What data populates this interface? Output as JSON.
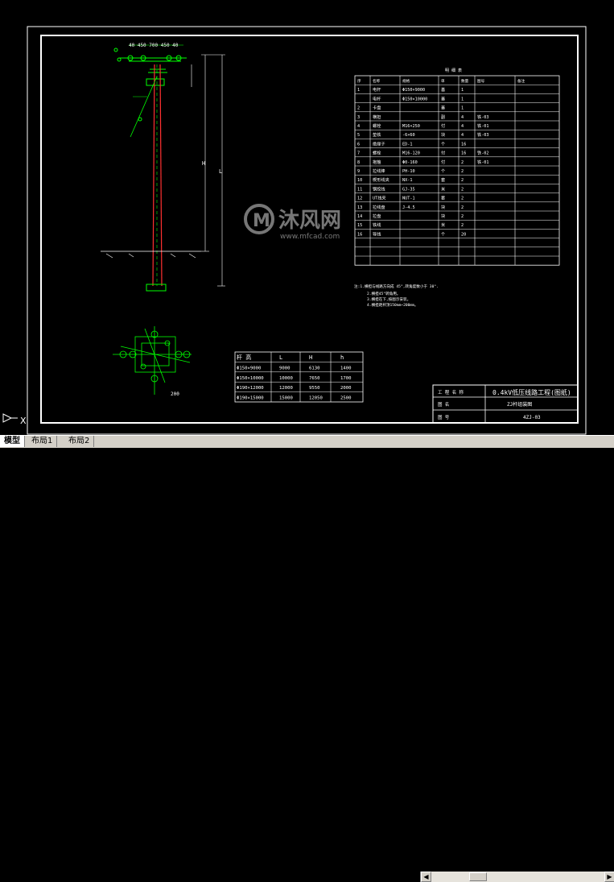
{
  "layout_tabs": [
    {
      "label": "模型",
      "active": true
    },
    {
      "label": "布局1",
      "active": false
    },
    {
      "label": "布局2",
      "active": false
    }
  ],
  "ucs_label": "X",
  "drawing": {
    "watermark": {
      "text": "沐风网",
      "url": "www.mfcad.com"
    },
    "material_table": {
      "title": "明 细 表",
      "headers": [
        "序",
        "名称",
        "规格",
        "单",
        "数量",
        "图号",
        "备注"
      ],
      "rows": [
        [
          "1",
          "电杆",
          "Φ150×9000",
          "基",
          "1",
          "",
          ""
        ],
        [
          "",
          "电杆",
          "Φ150×10000",
          "基",
          "1",
          "",
          ""
        ],
        [
          "2",
          "卡盘",
          "",
          "基",
          "1",
          "",
          ""
        ],
        [
          "3",
          "横担",
          "",
          "副",
          "4",
          "铁-03",
          ""
        ],
        [
          "4",
          "螺栓",
          "M16×250",
          "付",
          "4",
          "铁-01",
          ""
        ],
        [
          "5",
          "垫铁",
          "-6×60",
          "块",
          "4",
          "铁-03",
          ""
        ],
        [
          "6",
          "绝缘子",
          "ED-1",
          "个",
          "16",
          "",
          ""
        ],
        [
          "7",
          "螺栓",
          "M16-120",
          "付",
          "16",
          "铁-02",
          ""
        ],
        [
          "8",
          "抱箍",
          "Φ0-160",
          "付",
          "2",
          "铁-01",
          ""
        ],
        [
          "9",
          "拉线棒",
          "PH-10",
          "个",
          "2",
          "",
          ""
        ],
        [
          "10",
          "楔形线夹",
          "NX-1",
          "套",
          "2",
          "",
          ""
        ],
        [
          "11",
          "钢绞线",
          "GJ-35",
          "米",
          "2",
          "",
          ""
        ],
        [
          "12",
          "UT线夹",
          "NUT-1",
          "套",
          "2",
          "",
          ""
        ],
        [
          "13",
          "拉线盘",
          "J-4.5",
          "块",
          "2",
          "",
          ""
        ],
        [
          "14",
          "拉盘",
          "",
          "块",
          "2",
          "",
          ""
        ],
        [
          "15",
          "铁线",
          "",
          "米",
          "2",
          "",
          ""
        ],
        [
          "16",
          "导线",
          "",
          "个",
          "20",
          "",
          ""
        ]
      ]
    },
    "notes": [
      "注:1.横担与线路方向成 45°,转角度数小于 30°.",
      "2.横担45°转角用。",
      "3.横担在下,按图示安装。",
      "4.横担距杆顶150mm~200mm。"
    ],
    "dim_table": {
      "headers": [
        "杆 高",
        "L",
        "H",
        "h"
      ],
      "rows": [
        [
          "Φ150×9000",
          "9000",
          "6130",
          "1400"
        ],
        [
          "Φ150×10000",
          "10000",
          "7650",
          "1700"
        ],
        [
          "Φ190×12000",
          "12000",
          "9550",
          "2000"
        ],
        [
          "Φ190×15000",
          "15000",
          "12050",
          "2500"
        ]
      ]
    },
    "title_block": {
      "project_label": "工 程 名 称",
      "project_value": "0.4kV低压线路工程(图纸)",
      "drawing_label": "图    名",
      "drawing_value": "ZJ杆组装图",
      "number_label": "图    号",
      "number_value": "4ZJ-03"
    },
    "pole_labels": {
      "top_dims": "40 450 700 450 40",
      "height_mark": "H",
      "length_mark": "L",
      "plan_dim": "200"
    }
  }
}
